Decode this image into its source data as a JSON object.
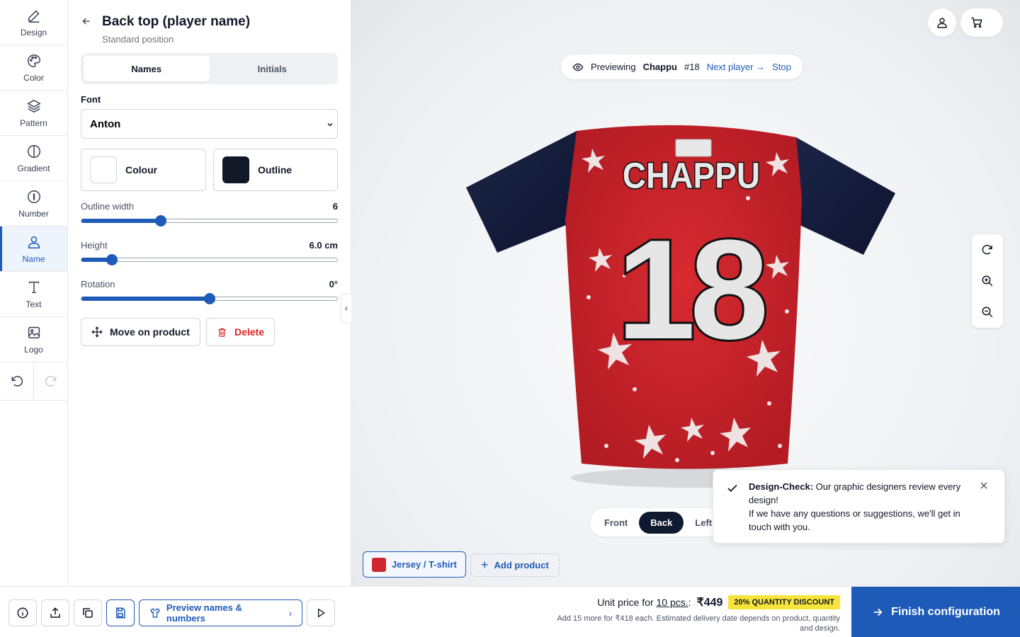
{
  "rail": {
    "items": [
      {
        "label": "Design",
        "icon": "pencil-icon"
      },
      {
        "label": "Color",
        "icon": "palette-icon"
      },
      {
        "label": "Pattern",
        "icon": "layers-icon"
      },
      {
        "label": "Gradient",
        "icon": "gradient-icon"
      },
      {
        "label": "Number",
        "icon": "number-icon"
      },
      {
        "label": "Name",
        "icon": "user-icon",
        "active": true
      },
      {
        "label": "Text",
        "icon": "text-icon"
      },
      {
        "label": "Logo",
        "icon": "image-icon"
      }
    ]
  },
  "panel": {
    "title": "Back top (player name)",
    "subtitle": "Standard position",
    "tabs": [
      "Names",
      "Initials"
    ],
    "selected_tab": "Names",
    "font_label": "Font",
    "font_value": "Anton",
    "colour_label": "Colour",
    "colour_value": "#ffffff",
    "outline_label": "Outline",
    "outline_value": "#111827",
    "outline_width": {
      "label": "Outline width",
      "value": "6",
      "fraction": 0.31
    },
    "height": {
      "label": "Height",
      "value": "6.0 cm",
      "fraction": 0.12
    },
    "rotation": {
      "label": "Rotation",
      "value": "0°",
      "fraction": 0.5
    },
    "move_label": "Move on product",
    "delete_label": "Delete"
  },
  "viewport": {
    "previewing_label": "Previewing",
    "player_name": "Chappu",
    "player_number": "#18",
    "next_player": "Next player",
    "stop": "Stop",
    "jersey_name": "CHAPPU",
    "jersey_number": "18",
    "view_tabs": [
      "Front",
      "Back",
      "Left"
    ],
    "selected_view": "Back",
    "toast_title": "Design-Check:",
    "toast_text1": "Our graphic designers review every design!",
    "toast_text2": "If we have any questions or suggestions, we'll get in touch with you.",
    "product_label": "Jersey / T-shirt",
    "add_product": "Add product",
    "jersey_color": "#d1252d",
    "sleeve_color": "#141c3a"
  },
  "bottom": {
    "preview_names": "Preview names & numbers",
    "unit_price_prefix": "Unit price for",
    "unit_qty": "10 pcs.",
    "unit_price": "₹449",
    "discount": "20% QUANTITY DISCOUNT",
    "note": "Add 15 more for ₹418 each. Estimated delivery date depends on product, quantity and design.",
    "finish": "Finish configuration"
  },
  "colors": {
    "accent": "#1e5bb8",
    "delete": "#dc2626",
    "discount_bg": "#f7e43a"
  }
}
